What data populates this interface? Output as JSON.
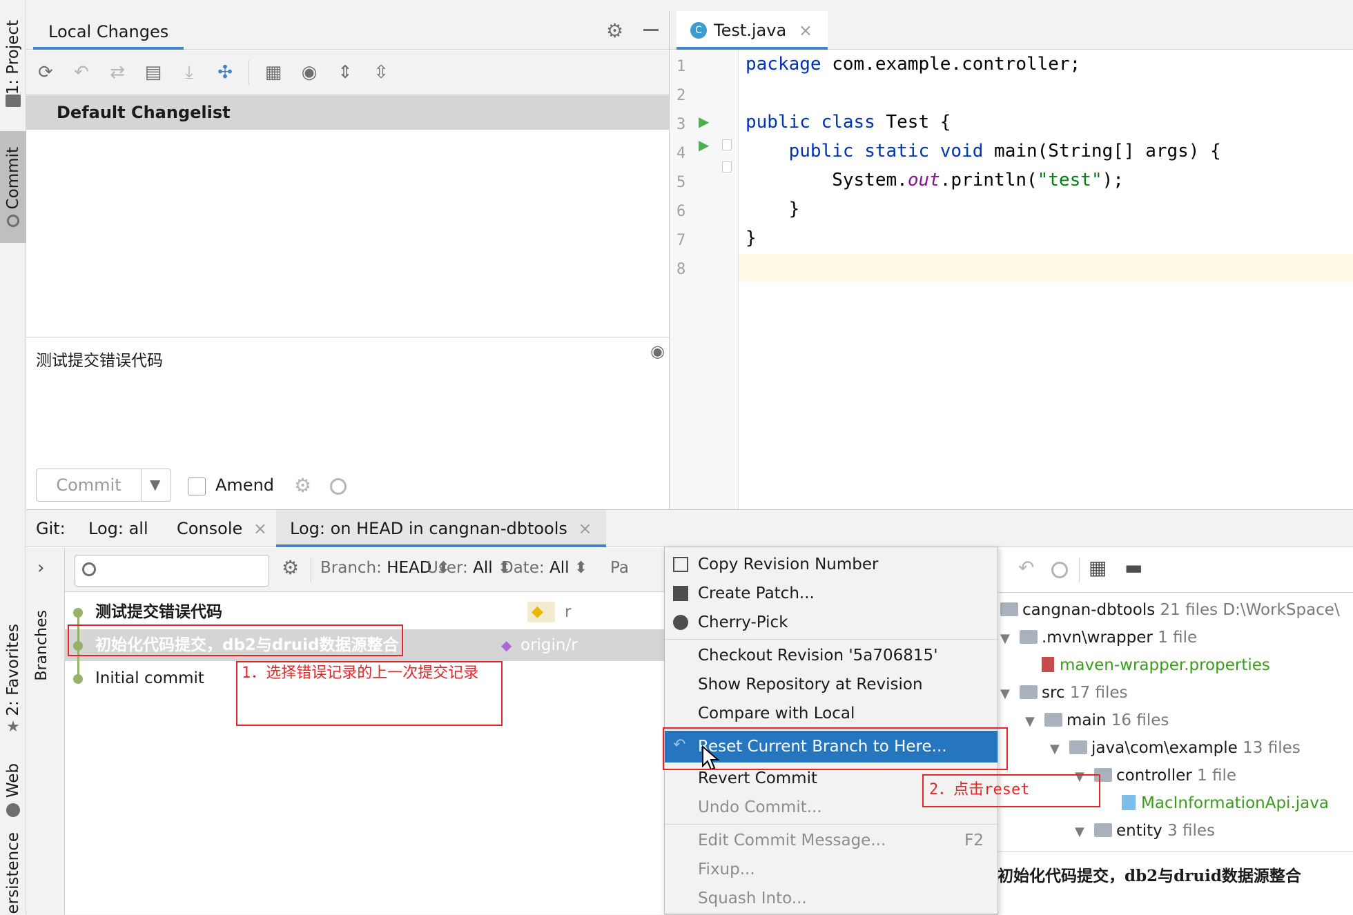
{
  "left_strip": {
    "project": "1: Project",
    "commit": "Commit",
    "favorites": "2: Favorites",
    "web": "Web",
    "persistence": "ersistence"
  },
  "commit_panel": {
    "tab": "Local Changes",
    "changelist": "Default Changelist",
    "message": "测试提交错误代码",
    "commit_button": "Commit",
    "amend_label": "Amend"
  },
  "editor": {
    "tab_title": "Test.java",
    "lines": [
      {
        "no": "1",
        "code": [
          {
            "t": "package",
            "c": "kw"
          },
          {
            "t": " com.example.controller;",
            "c": ""
          }
        ]
      },
      {
        "no": "2",
        "code": []
      },
      {
        "no": "3",
        "code": [
          {
            "t": "public class",
            "c": "kw"
          },
          {
            "t": " Test {",
            "c": ""
          }
        ]
      },
      {
        "no": "4",
        "code": [
          {
            "t": "    ",
            "c": ""
          },
          {
            "t": "public static void",
            "c": "kw"
          },
          {
            "t": " main(String[] args) {",
            "c": ""
          }
        ]
      },
      {
        "no": "5",
        "code": [
          {
            "t": "        System.",
            "c": ""
          },
          {
            "t": "out",
            "c": "fld"
          },
          {
            "t": ".println(",
            "c": ""
          },
          {
            "t": "\"test\"",
            "c": "str"
          },
          {
            "t": ");",
            "c": ""
          }
        ]
      },
      {
        "no": "6",
        "code": [
          {
            "t": "    }",
            "c": ""
          }
        ]
      },
      {
        "no": "7",
        "code": [
          {
            "t": "}",
            "c": ""
          }
        ]
      },
      {
        "no": "8",
        "code": []
      }
    ]
  },
  "git": {
    "tabs": {
      "git_label": "Git:",
      "log_all": "Log: all",
      "console": "Console",
      "log_head": "Log: on HEAD in cangnan-dbtools"
    },
    "branches_label": "Branches",
    "filters": {
      "branch_label": "Branch:",
      "branch_value": "HEAD",
      "user_label": "User:",
      "user_value": "All",
      "date_label": "Date:",
      "date_value": "All",
      "path_partial": "Pa"
    },
    "commits": [
      {
        "message": "测试提交错误代码",
        "tag": "r"
      },
      {
        "message": "初始化代码提交，db2与druid数据源整合",
        "tag": "origin/r"
      },
      {
        "message": "Initial commit",
        "tag": ""
      }
    ],
    "details": {
      "tree": [
        {
          "name": "cangnan-dbtools",
          "meta": "21 files  D:\\WorkSpace\\",
          "type": "folder"
        },
        {
          "name": ".mvn\\wrapper",
          "meta": "1 file",
          "type": "folder"
        },
        {
          "name": "maven-wrapper.properties",
          "meta": "",
          "type": "file-green"
        },
        {
          "name": "src",
          "meta": "17 files",
          "type": "folder"
        },
        {
          "name": "main",
          "meta": "16 files",
          "type": "folder"
        },
        {
          "name": "java\\com\\example",
          "meta": "13 files",
          "type": "folder"
        },
        {
          "name": "controller",
          "meta": "1 file",
          "type": "folder"
        },
        {
          "name": "MacInformationApi.java",
          "meta": "",
          "type": "file-green"
        },
        {
          "name": "entity",
          "meta": "3 files",
          "type": "folder"
        }
      ],
      "commit_message": "初始化代码提交，db2与druid数据源整合"
    }
  },
  "context_menu": {
    "items": [
      {
        "label": "Copy Revision Number",
        "shortcut": "",
        "disabled": false
      },
      {
        "label": "Create Patch...",
        "shortcut": "",
        "disabled": false
      },
      {
        "label": "Cherry-Pick",
        "shortcut": "",
        "disabled": false
      },
      {
        "label": "Checkout Revision '5a706815'",
        "shortcut": "",
        "disabled": false
      },
      {
        "label": "Show Repository at Revision",
        "shortcut": "",
        "disabled": false
      },
      {
        "label": "Compare with Local",
        "shortcut": "",
        "disabled": false
      },
      {
        "label": "Reset Current Branch to Here...",
        "shortcut": "",
        "disabled": false
      },
      {
        "label": "Revert Commit",
        "shortcut": "",
        "disabled": false
      },
      {
        "label": "Undo Commit...",
        "shortcut": "",
        "disabled": true
      },
      {
        "label": "Edit Commit Message...",
        "shortcut": "F2",
        "disabled": true
      },
      {
        "label": "Fixup...",
        "shortcut": "",
        "disabled": true
      },
      {
        "label": "Squash Into...",
        "shortcut": "",
        "disabled": true
      }
    ]
  },
  "annotations": {
    "step1": "1．选择错误记录的上一次提交记录",
    "step2": "2．点击reset"
  },
  "colors": {
    "accent": "#4083c9",
    "selection": "#2675bf",
    "annotation": "#e3262a",
    "keyword": "#0033b3",
    "string": "#067d17",
    "field": "#871094",
    "graph": "#96b26a"
  }
}
